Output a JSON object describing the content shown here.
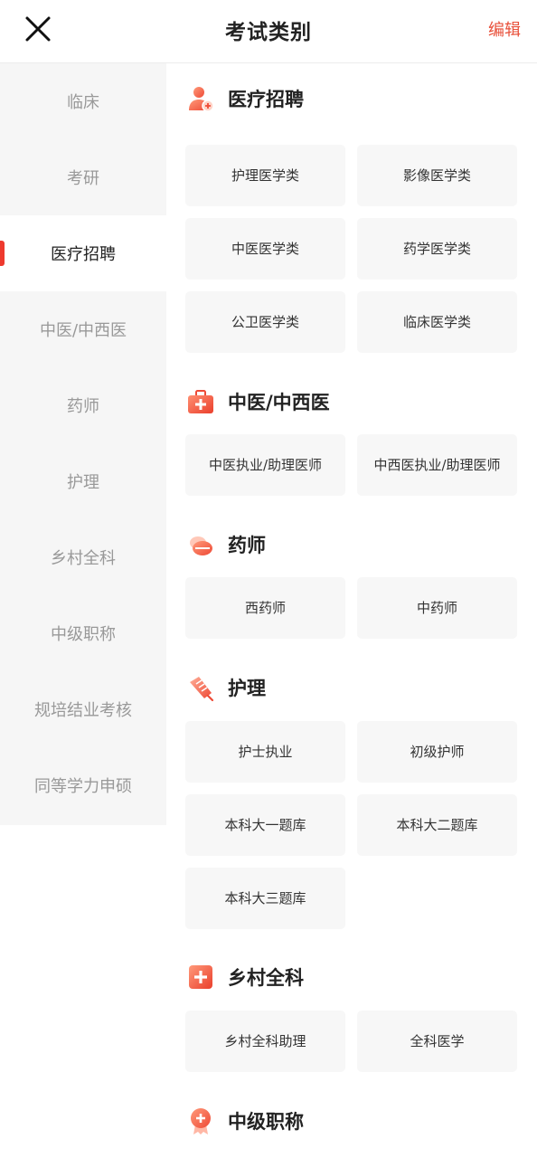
{
  "header": {
    "title": "考试类别",
    "edit_label": "编辑"
  },
  "sidebar": {
    "items": [
      {
        "label": "临床"
      },
      {
        "label": "考研"
      },
      {
        "label": "医疗招聘"
      },
      {
        "label": "中医/中西医"
      },
      {
        "label": "药师"
      },
      {
        "label": "护理"
      },
      {
        "label": "乡村全科"
      },
      {
        "label": "中级职称"
      },
      {
        "label": "规培结业考核"
      },
      {
        "label": "同等学力申硕"
      }
    ],
    "active_label": "医疗招聘"
  },
  "sections": [
    {
      "title": "医疗招聘",
      "icon": "doctor-icon",
      "items": [
        "护理医学类",
        "影像医学类",
        "中医医学类",
        "药学医学类",
        "公卫医学类",
        "临床医学类"
      ]
    },
    {
      "title": "中医/中西医",
      "icon": "medical-kit-icon",
      "items": [
        "中医执业/助理医师",
        "中西医执业/助理医师"
      ]
    },
    {
      "title": "药师",
      "icon": "pills-icon",
      "items": [
        "西药师",
        "中药师"
      ]
    },
    {
      "title": "护理",
      "icon": "syringe-icon",
      "items": [
        "护士执业",
        "初级护师",
        "本科大一题库",
        "本科大二题库",
        "本科大三题库"
      ]
    },
    {
      "title": "乡村全科",
      "icon": "medical-cross-icon",
      "items": [
        "乡村全科助理",
        "全科医学"
      ]
    },
    {
      "title": "中级职称",
      "icon": "medal-icon",
      "items": []
    }
  ],
  "colors": {
    "accent": "#e8503a",
    "active_marker": "#ee3a2e",
    "sidebar_bg": "#f6f6f6",
    "tile_bg": "#f7f7f7"
  }
}
